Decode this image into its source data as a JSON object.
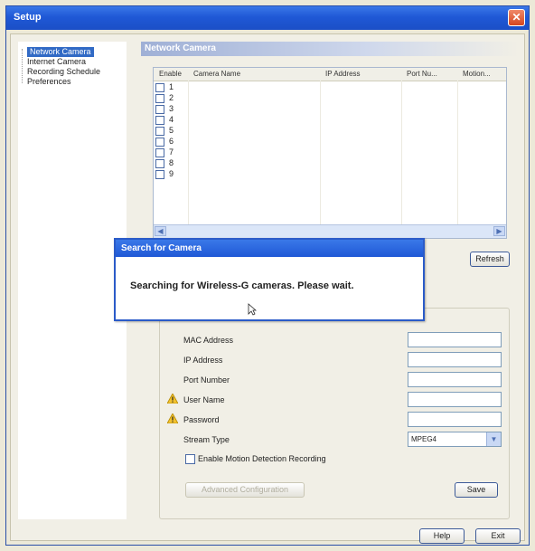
{
  "window": {
    "title": "Setup",
    "close_icon": "close-icon"
  },
  "nav": {
    "items": [
      {
        "label": "Network Camera",
        "selected": true
      },
      {
        "label": "Internet Camera",
        "selected": false
      },
      {
        "label": "Recording Schedule",
        "selected": false
      },
      {
        "label": "Preferences",
        "selected": false
      }
    ]
  },
  "panel": {
    "header": "Network Camera",
    "table": {
      "columns": [
        "Enable",
        "Camera Name",
        "IP Address",
        "Port Nu...",
        "Motion..."
      ],
      "rows": [
        "1",
        "2",
        "3",
        "4",
        "5",
        "6",
        "7",
        "8",
        "9"
      ]
    },
    "refresh_label": "Refresh",
    "fields": {
      "mac_label": "MAC Address",
      "ip_label": "IP Address",
      "port_label": "Port Number",
      "user_label": "User Name",
      "password_label": "Password",
      "stream_label": "Stream Type",
      "stream_value": "MPEG4",
      "motion_label": "Enable Motion Detection Recording"
    },
    "advanced_label": "Advanced Configuration",
    "save_label": "Save"
  },
  "footer": {
    "help_label": "Help",
    "exit_label": "Exit"
  },
  "dialog": {
    "title": "Search for Camera",
    "message": "Searching for Wireless-G cameras. Please wait."
  },
  "colors": {
    "titlebar": "#1f58d6",
    "selection": "#316ac5",
    "warning": "#f2c12e"
  }
}
